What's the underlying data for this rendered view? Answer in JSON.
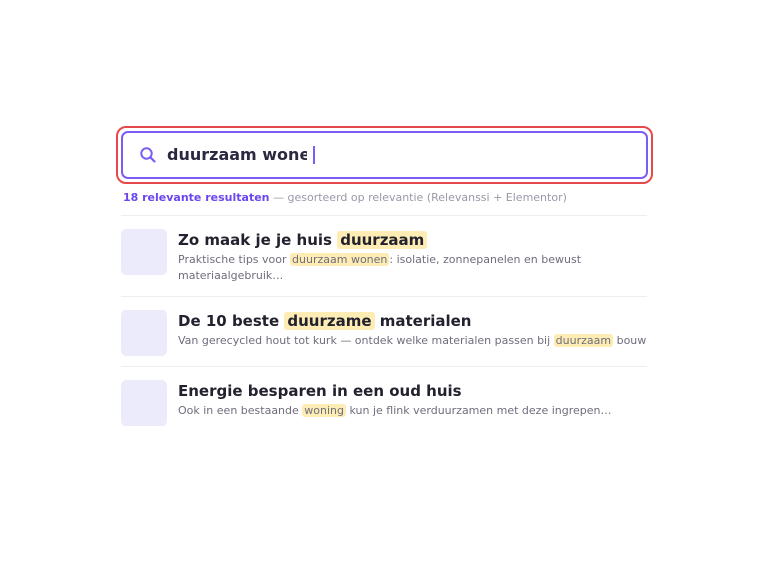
{
  "search": {
    "query": "duurzaam wonen",
    "accent_color": "#7c5cf5",
    "outline_color": "#e5484d",
    "icon": "search-icon"
  },
  "summary": {
    "count_label": "18 relevante resultaten",
    "sort_label": " — gesorteerd op relevantie (Relevanssi + Elementor)"
  },
  "results": [
    {
      "title_before": "Zo maak je je huis ",
      "title_highlight": "duurzaam",
      "title_after": "",
      "snippet_before": "Praktische tips voor ",
      "snippet_highlight": "duurzaam wonen",
      "snippet_after": ": isolatie, zonnepanelen en bewust materiaalgebruik…"
    },
    {
      "title_before": "De 10 beste ",
      "title_highlight": "duurzame",
      "title_after": " materialen",
      "snippet_before": "Van gerecycled hout tot kurk — ontdek welke materialen passen bij ",
      "snippet_highlight": "duurzaam",
      "snippet_after": " bouwen…"
    },
    {
      "title_before": "Energie besparen in een oud huis",
      "title_highlight": "",
      "title_after": "",
      "snippet_before": "Ook in een bestaande ",
      "snippet_highlight": "woning",
      "snippet_after": " kun je flink verduurzamen met deze ingrepen…"
    }
  ]
}
